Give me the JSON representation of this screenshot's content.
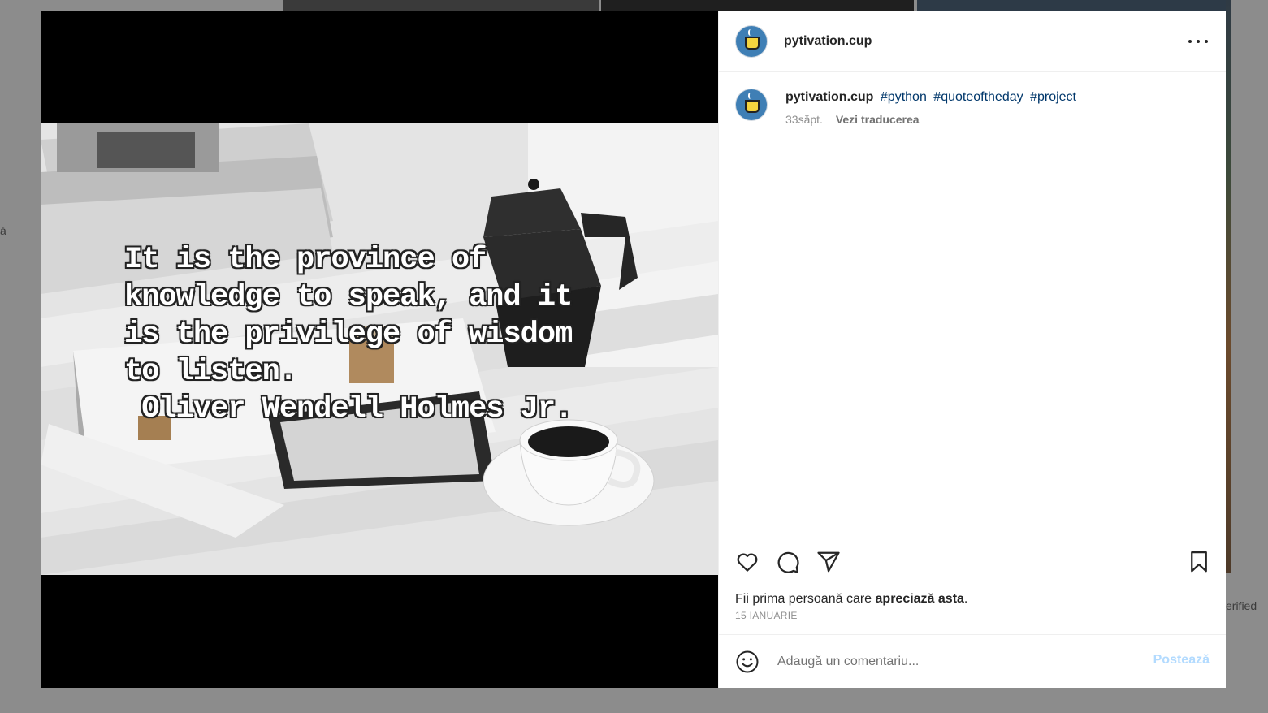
{
  "background": {
    "left_text": "ă",
    "right_text": "erified"
  },
  "post": {
    "quote_lines": [
      "It is the province of",
      "knowledge to speak, and it",
      "is the privilege of wisdom",
      "to listen.",
      " Oliver Wendell Holmes Jr."
    ]
  },
  "header": {
    "username": "pytivation.cup",
    "more_icon": "more-horizontal-icon"
  },
  "caption": {
    "username": "pytivation.cup",
    "hashtags": [
      "#python",
      "#quoteoftheday",
      "#project"
    ],
    "age": "33săpt.",
    "translate_label": "Vezi traducerea"
  },
  "actions": {
    "like_icon": "heart-icon",
    "comment_icon": "comment-icon",
    "share_icon": "share-icon",
    "save_icon": "bookmark-icon"
  },
  "likes": {
    "prefix": "Fii prima persoană care ",
    "bold": "apreciază asta",
    "suffix": ".",
    "date": "15 IANUARIE"
  },
  "comment": {
    "placeholder": "Adaugă un comentariu...",
    "post_label": "Postează",
    "emoji_icon": "emoji-icon"
  },
  "colors": {
    "hashtag": "#00376b",
    "post_button_disabled": "#b3dbff",
    "secondary_text": "#8e8e8e"
  }
}
